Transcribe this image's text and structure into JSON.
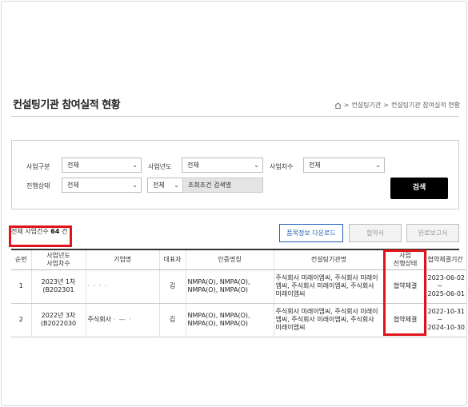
{
  "page": {
    "title": "컨설팅기관 참여실적 현황"
  },
  "breadcrumb": {
    "items": [
      "컨설팅기관",
      "컨설팅기관 참여실적 현황"
    ]
  },
  "search": {
    "business_type_label": "사업구분",
    "business_type_value": "전체",
    "business_year_label": "사업년도",
    "business_year_value": "전체",
    "business_round_label": "사업차수",
    "business_round_value": "전체",
    "progress_label": "진행상태",
    "progress_value": "전체",
    "condition_value": "전체",
    "keyword_placeholder": "조회조건 검색명",
    "search_button": "검색"
  },
  "summary": {
    "prefix": "전체 사업건수",
    "count": "64",
    "unit": "건"
  },
  "actions": {
    "download": "품목정보 다운로드",
    "agreement": "협약서",
    "report": "완료보고서"
  },
  "table": {
    "headers": {
      "no": "순번",
      "year_round_1": "사업년도",
      "year_round_2": "사업차수",
      "company": "기업명",
      "ceo": "대표자",
      "cert": "인증명칭",
      "consultant": "컨설팅기관명",
      "status_1": "사업",
      "status_2": "진행상태",
      "period": "협약체결기간"
    },
    "rows": [
      {
        "no": "1",
        "year_round": "2023년 1차",
        "code": "(B202301",
        "company_masked": "· · · ·",
        "ceo": "김",
        "cert": "NMPA(O), NMPA(O), NMPA(O), NMPA(O)",
        "consultant": "주식회사 미래이엠씨, 주식회사 미래이엠씨, 주식회사 미래이엠씨, 주식회사 미래이엠씨",
        "status": "협약체결",
        "period_start": "2023-06-02",
        "period_sep": "~",
        "period_end": "2025-06-01"
      },
      {
        "no": "2",
        "year_round": "2022년 3차",
        "code": "(B2022030",
        "company_masked": "주식회사",
        "company_masked_2": "· — ·",
        "ceo": "김",
        "cert": "NMPA(O), NMPA(O), NMPA(O), NMPA(O)",
        "consultant": "주식회사 미래이엠씨, 주식회사 미래이엠씨, 주식회사 미래이엠씨, 주식회사 미래이엠씨",
        "status": "협약체결",
        "period_start": "2022-10-31",
        "period_sep": "~",
        "period_end": "2024-10-30"
      }
    ]
  },
  "colors": {
    "highlight": "#e0141b",
    "primary": "#1f5fb7",
    "search_button": "#000000"
  }
}
